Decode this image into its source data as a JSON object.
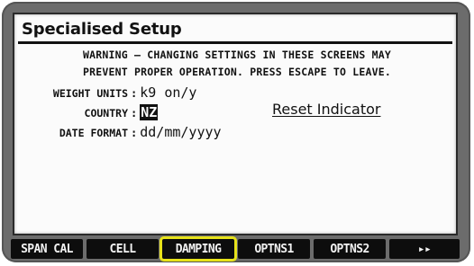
{
  "screen": {
    "title": "Specialised Setup",
    "warning_line1": "WARNING – CHANGING SETTINGS IN THESE SCREENS MAY",
    "warning_line2": "PREVENT PROPER OPERATION. PRESS ESCAPE TO LEAVE.",
    "settings": [
      {
        "label": "WEIGHT UNITS",
        "value": "k9 on/y"
      },
      {
        "label": "COUNTRY",
        "value": "NZ"
      },
      {
        "label": "DATE FORMAT",
        "value": "dd/mm/yyyy"
      }
    ],
    "reset_link": "Reset Indicator"
  },
  "softkeys": [
    {
      "label": "SPAN CAL"
    },
    {
      "label": "CELL"
    },
    {
      "label": "DAMPING",
      "highlighted": true
    },
    {
      "label": "OPTNS1"
    },
    {
      "label": "OPTNS2"
    },
    {
      "label": "▸▸"
    }
  ],
  "colors": {
    "highlight": "#e7e21a",
    "bezel": "#6c6c6c",
    "screen": "#fbfbfb"
  }
}
